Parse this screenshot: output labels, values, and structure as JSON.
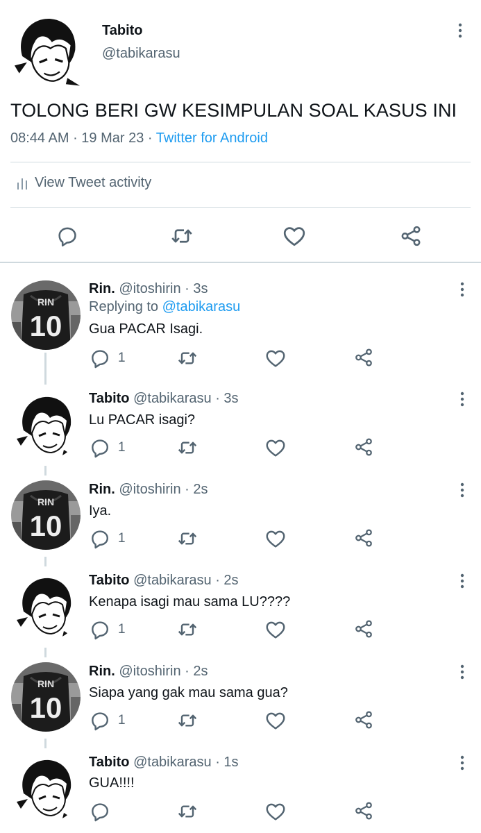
{
  "main_tweet": {
    "name": "Tabito",
    "handle": "@tabikarasu",
    "text": "TOLONG BERI GW KESIMPULAN SOAL KASUS INI",
    "time": "08:44 AM",
    "date": "19 Mar 23",
    "source": "Twitter for Android",
    "activity_label": "View Tweet activity",
    "separator": " · "
  },
  "replies": [
    {
      "name": "Rin.",
      "handle": "@itoshirin · 3s",
      "replying_prefix": "Replying to ",
      "replying_to": "@tabikarasu",
      "text": "Gua PACAR Isagi.",
      "reply_count": "1"
    },
    {
      "name": "Tabito",
      "handle": "@tabikarasu · 3s",
      "text": "Lu PACAR isagi?",
      "reply_count": "1"
    },
    {
      "name": "Rin.",
      "handle": "@itoshirin · 2s",
      "text": "Iya.",
      "reply_count": "1"
    },
    {
      "name": "Tabito",
      "handle": "@tabikarasu · 2s",
      "text": "Kenapa isagi mau sama LU????",
      "reply_count": "1"
    },
    {
      "name": "Rin.",
      "handle": "@itoshirin · 2s",
      "text": "Siapa yang gak mau sama gua?",
      "reply_count": "1"
    },
    {
      "name": "Tabito",
      "handle": "@tabikarasu · 1s",
      "text": "GUA!!!!",
      "reply_count": ""
    }
  ],
  "jersey": {
    "label": "RIN",
    "number": "10"
  },
  "icons": {
    "reply": "reply-icon",
    "retweet": "retweet-icon",
    "like": "like-icon",
    "share": "share-icon",
    "more": "more-icon",
    "activity": "bar-chart-icon"
  },
  "colors": {
    "link": "#1d9bf0",
    "secondary": "#536471",
    "divider": "#cfd9de",
    "text": "#0f1419"
  }
}
